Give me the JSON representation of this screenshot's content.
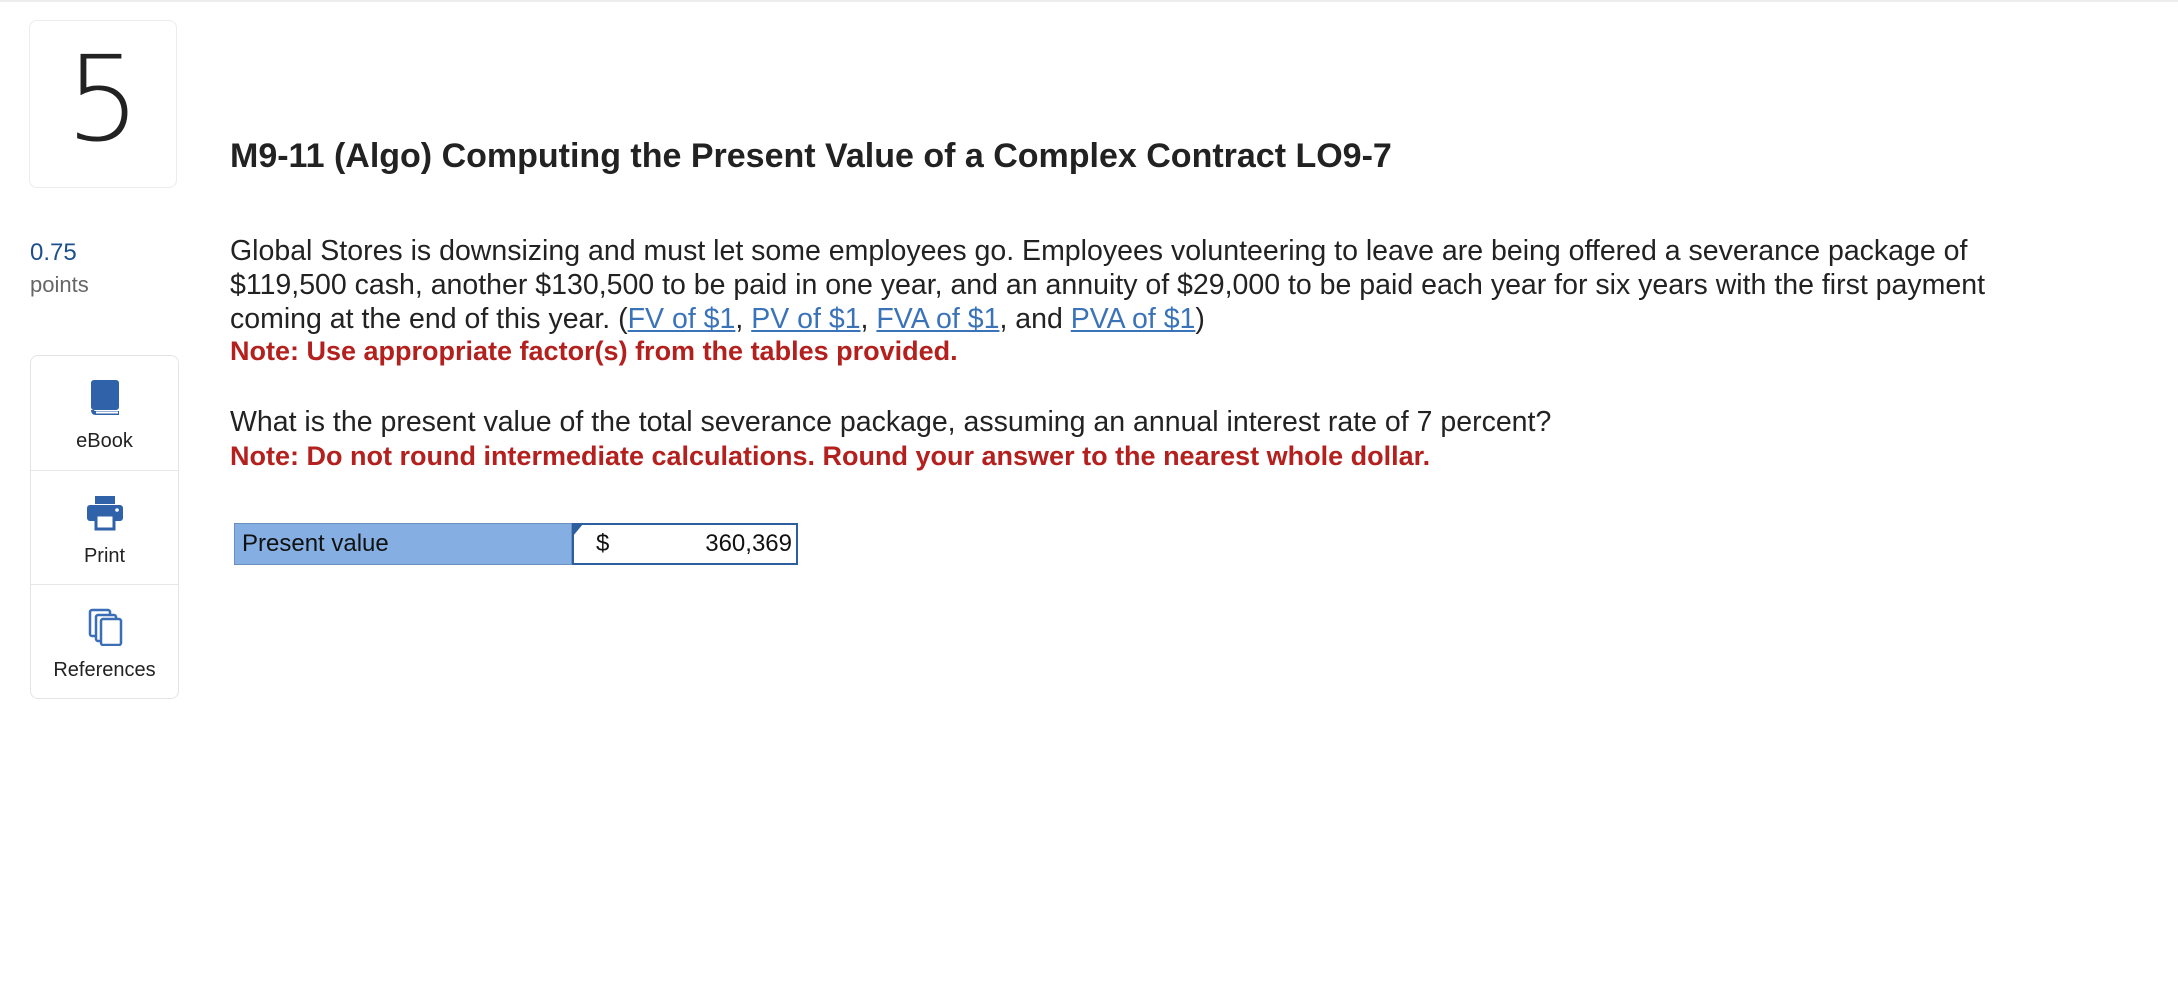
{
  "question": {
    "number": "5"
  },
  "points": {
    "value": "0.75",
    "label": "points"
  },
  "tools": [
    {
      "label": "eBook",
      "icon": "book-icon"
    },
    {
      "label": "Print",
      "icon": "printer-icon"
    },
    {
      "label": "References",
      "icon": "copy-icon"
    }
  ],
  "title": "M9-11 (Algo) Computing the Present Value of a Complex Contract LO9-7",
  "body": {
    "text_main": "Global Stores is downsizing and must let some employees go. Employees volunteering to leave are being offered a severance package of $119,500 cash, another $130,500 to be paid in one year, and an annuity of $29,000 to be paid each year for six years with the first payment coming at the end of this year. (",
    "links": [
      "FV of $1",
      "PV of $1",
      "FVA of $1",
      "PVA of $1"
    ],
    "sep_comma": ", ",
    "sep_and": ", and ",
    "close_paren": ")",
    "note1": "Note: Use appropriate factor(s) from the tables provided.",
    "question": "What is the present value of the total severance package, assuming an annual interest rate of 7 percent?",
    "note2": "Note: Do not round intermediate calculations. Round your answer to the nearest whole dollar."
  },
  "answer": {
    "label": "Present value",
    "currency": "$",
    "value": "360,369"
  },
  "colors": {
    "accent": "#1d4f8c",
    "link": "#3b73b9",
    "note": "#b3201e",
    "answer_label_bg": "#85afe2"
  }
}
